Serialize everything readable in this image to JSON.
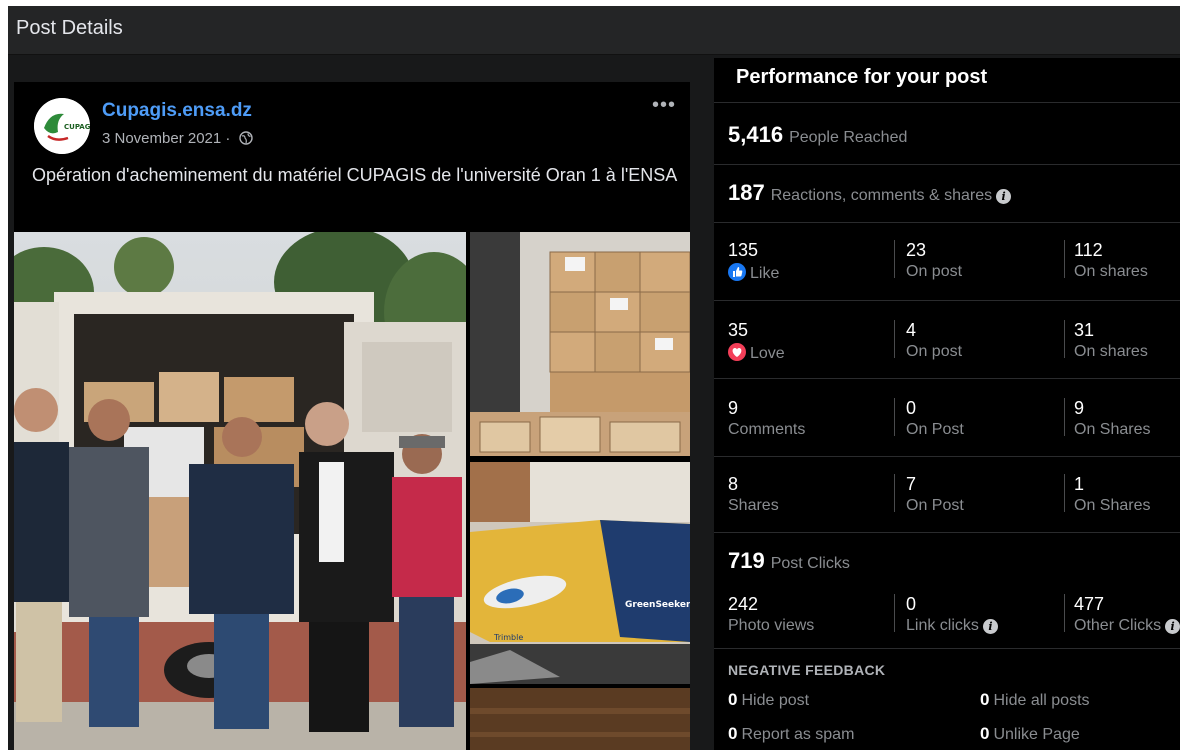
{
  "topbar": {
    "title": "Post Details"
  },
  "post": {
    "page_name": "Cupagis.ensa.dz",
    "date": "3 November 2021 ·",
    "more_label": "•••",
    "text": "Opération d'acheminement du matériel CUPAGIS de l'université Oran 1 à l'ENSA",
    "avatar_logo_text": "CUPAGIS",
    "box_brand_text": "GreenSeeker",
    "box_brand2_text": "Trimble"
  },
  "performance": {
    "title": "Performance for your post",
    "reached": {
      "value": "5,416",
      "label": "People Reached"
    },
    "engagement": {
      "value": "187",
      "label": "Reactions, comments & shares"
    },
    "rows": [
      {
        "c1": {
          "num": "135",
          "sub": "Like",
          "icon": "like-icon"
        },
        "c2": {
          "num": "23",
          "sub": "On post"
        },
        "c3": {
          "num": "112",
          "sub": "On shares"
        }
      },
      {
        "c1": {
          "num": "35",
          "sub": "Love",
          "icon": "love-icon"
        },
        "c2": {
          "num": "4",
          "sub": "On post"
        },
        "c3": {
          "num": "31",
          "sub": "On shares"
        }
      },
      {
        "c1": {
          "num": "9",
          "sub": "Comments"
        },
        "c2": {
          "num": "0",
          "sub": "On Post"
        },
        "c3": {
          "num": "9",
          "sub": "On Shares"
        }
      },
      {
        "c1": {
          "num": "8",
          "sub": "Shares"
        },
        "c2": {
          "num": "7",
          "sub": "On Post"
        },
        "c3": {
          "num": "1",
          "sub": "On Shares"
        }
      }
    ],
    "clicks": {
      "value": "719",
      "label": "Post Clicks",
      "photo": {
        "num": "242",
        "sub": "Photo views"
      },
      "link": {
        "num": "0",
        "sub": "Link clicks"
      },
      "other": {
        "num": "477",
        "sub": "Other Clicks"
      }
    },
    "negative": {
      "title": "NEGATIVE FEEDBACK",
      "hide_post": {
        "num": "0",
        "label": "Hide post"
      },
      "hide_all": {
        "num": "0",
        "label": "Hide all posts"
      },
      "report": {
        "num": "0",
        "label": "Report as spam"
      },
      "unlike": {
        "num": "0",
        "label": "Unlike Page"
      }
    }
  },
  "colors": {
    "background": "#18191a",
    "panel": "#000000",
    "page_name": "#4e9cf7",
    "like": "#1877f2",
    "love": "#f33e58"
  }
}
